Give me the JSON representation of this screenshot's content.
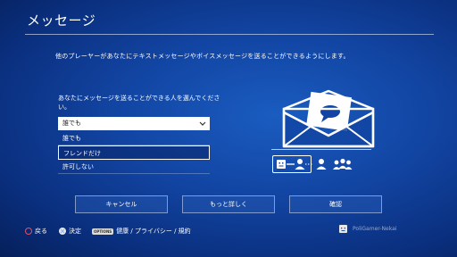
{
  "header": {
    "title": "メッセージ"
  },
  "description": "他のプレーヤーがあなたにテキストメッセージやボイスメッセージを送ることができるようにします。",
  "setting": {
    "prompt": "あなたにメッセージを送ることができる人を選んでください。",
    "current_value": "誰でも",
    "options": [
      "誰でも",
      "フレンドだけ",
      "許可しない"
    ],
    "highlighted_option": "フレンドだけ"
  },
  "buttons": {
    "cancel": "キャンセル",
    "more": "もっと詳しく",
    "confirm": "確認"
  },
  "footer": {
    "back": "戻る",
    "enter": "決定",
    "options_key": "OPTIONS",
    "options_label": "健康 / プライバシー / 規約",
    "user_name": "PoliGamer-Nekai"
  },
  "icons": {
    "envelope": "envelope-icon",
    "speech_bubble": "speech-bubble-icon",
    "circle": "circle-button-icon",
    "cross": "cross-button-icon"
  },
  "colors": {
    "background": "#1245a3",
    "circle_button": "#e0506a",
    "cross_button": "#8fb3e8"
  }
}
